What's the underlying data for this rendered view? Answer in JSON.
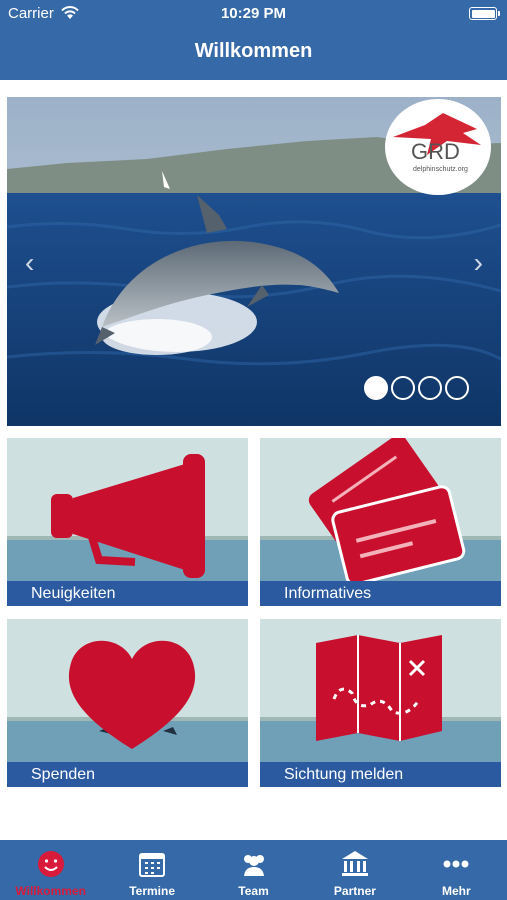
{
  "status_bar": {
    "carrier": "Carrier",
    "time": "10:29 PM"
  },
  "nav": {
    "title": "Willkommen"
  },
  "slider": {
    "slide_count": 4,
    "active_index": 0,
    "logo_text": "GRD",
    "logo_subtext": "delphinschutz.org"
  },
  "tiles": [
    {
      "label": "Neuigkeiten",
      "icon": "megaphone-icon"
    },
    {
      "label": "Informatives",
      "icon": "cards-icon"
    },
    {
      "label": "Spenden",
      "icon": "heart-icon"
    },
    {
      "label": "Sichtung melden",
      "icon": "map-icon"
    }
  ],
  "tabbar": {
    "items": [
      {
        "label": "Willkommen",
        "icon": "smiley-icon",
        "active": true
      },
      {
        "label": "Termine",
        "icon": "calendar-icon",
        "active": false
      },
      {
        "label": "Team",
        "icon": "people-icon",
        "active": false
      },
      {
        "label": "Partner",
        "icon": "bank-icon",
        "active": false
      },
      {
        "label": "Mehr",
        "icon": "more-icon",
        "active": false
      }
    ]
  },
  "colors": {
    "header": "#3669a7",
    "accent": "#c8102e",
    "label_bar": "#2b5aa0"
  }
}
